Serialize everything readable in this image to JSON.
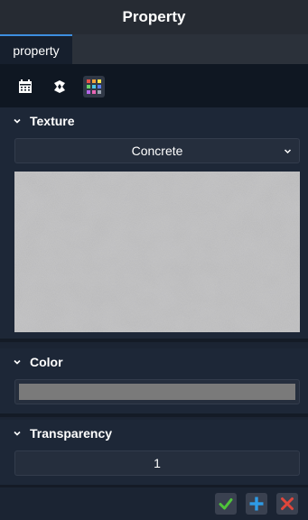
{
  "header": {
    "title": "Property"
  },
  "tabs": [
    {
      "label": "property"
    }
  ],
  "toolbar": {
    "icons": [
      "calendar-icon",
      "cloud-shape-icon",
      "color-grid-icon"
    ],
    "active": "color-grid-icon"
  },
  "texture": {
    "title": "Texture",
    "selected": "Concrete"
  },
  "color": {
    "title": "Color",
    "value": "#7a7a7a"
  },
  "transparency": {
    "title": "Transparency",
    "value": "1"
  },
  "footer": {
    "icons": [
      "confirm-icon",
      "add-icon",
      "delete-icon"
    ]
  },
  "colors": {
    "accent": "#3d8fe0",
    "confirm": "#4fc43a",
    "add": "#2e9be6",
    "delete": "#e0463b"
  }
}
